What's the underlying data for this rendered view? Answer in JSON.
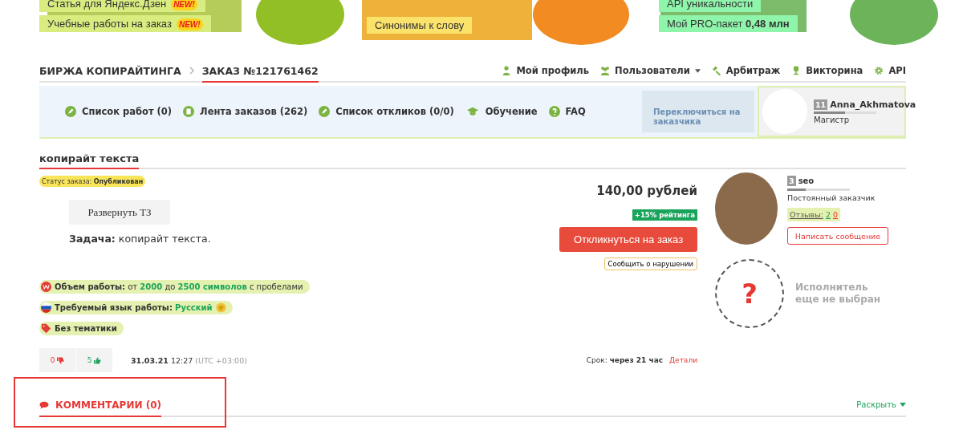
{
  "banner": {
    "groups": [
      {
        "kind": "green",
        "links": [
          {
            "label": "Статья для Яндекс.Дзен",
            "badge": "NEW!"
          },
          {
            "label": "Учебные работы на заказ",
            "badge": "NEW!"
          }
        ]
      },
      {
        "kind": "orange",
        "links": [
          {
            "label": "Синонимы к слову"
          }
        ]
      },
      {
        "kind": "mint",
        "links": [
          {
            "label": "API уникальности"
          },
          {
            "label": "Мой PRO-пакет **0,48 млн**"
          }
        ]
      }
    ]
  },
  "breadcrumbs": [
    {
      "label": "БИРЖА КОПИРАЙТИНГА",
      "selected": false
    },
    {
      "label": "ЗАКАЗ №121761462",
      "selected": true
    }
  ],
  "top_menu": [
    {
      "label": "Мой профиль",
      "dropdown": false
    },
    {
      "label": "Пользователи",
      "dropdown": true
    },
    {
      "label": "Арбитраж",
      "dropdown": false
    },
    {
      "label": "Викторина",
      "dropdown": false
    },
    {
      "label": "API",
      "dropdown": false
    }
  ],
  "sub_nav": [
    "Список работ (0)",
    "Лента заказов (262)",
    "Список откликов (0/0)",
    "Обучение",
    "FAQ"
  ],
  "switch_button": "Переключиться на заказчика",
  "user": {
    "level_number": "11",
    "name": "Anna_Akhmatova",
    "level": 0.5,
    "rank": "Магистр"
  },
  "order": {
    "title": "копирайт текста",
    "status_label": "Статус заказа:",
    "status": "Опубликован",
    "expand_button": "Развернуть ТЗ",
    "task": "**Задача:** копирайт текста.",
    "price": "140,00 рублей",
    "rating_badge": "+15% рейтинга",
    "respond_button": "Откликнуться на заказ",
    "report_button": "Сообщить о нарушении",
    "tags": [
      {
        "kind": "volume",
        "text": "**Объем работы:** от **2000** до **2500 символов** с пробелами"
      },
      {
        "kind": "language",
        "text": "**Требуемый язык работы:** **Русский**"
      },
      {
        "kind": "topic",
        "text": "Без тематики"
      }
    ],
    "dislikes": "0",
    "likes": "5",
    "date": "31.03.21",
    "time": "12:27",
    "timezone": "(UTC +03:00)",
    "deadline_label": "Срок:",
    "deadline": "через 21 час",
    "details_link": "Детали"
  },
  "customer": {
    "level_number": "3",
    "name": "seo",
    "level": 0.3,
    "role": "Постоянный заказчик",
    "reviews_label": "Отзывы:",
    "positive": "2",
    "negative": "0",
    "message_button": "Написать сообщение"
  },
  "executor": {
    "mark": "?",
    "text": "Исполнитель еще не выбран"
  },
  "comments": {
    "title": "КОММЕНТАРИИ (0)",
    "expand": "Раскрыть"
  }
}
